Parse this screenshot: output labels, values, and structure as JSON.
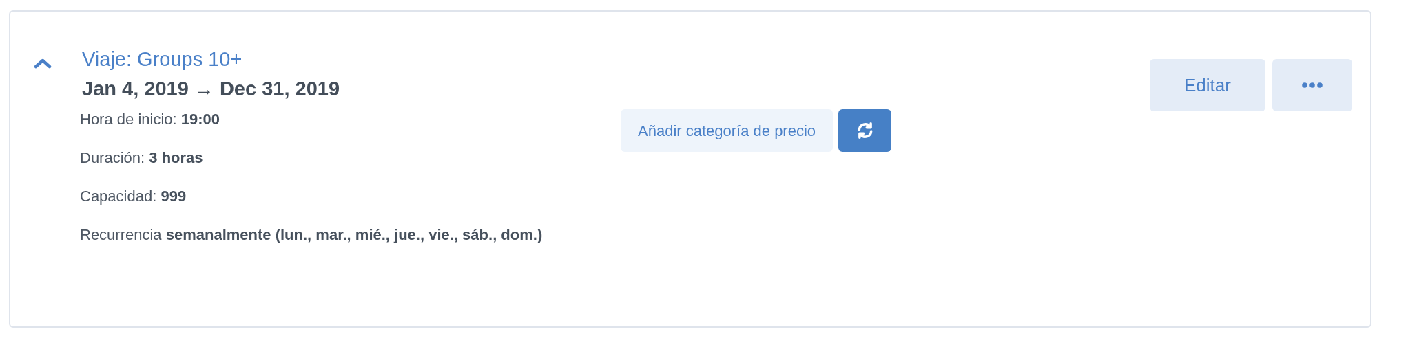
{
  "trip": {
    "expanded": true,
    "title": "Viaje: Groups 10+",
    "dates": "Jan 4, 2019 → Dec 31, 2019",
    "details": [
      "Hora de inicio: **19:00**",
      "Duración: **3 horas**",
      "Capacidad: **999**",
      "Recurrencia **semanalmente (lun., mar., mié., jue., vie., sáb., dom.)**"
    ],
    "add_price_category": "Añadir categoría de precio",
    "edit": "Editar"
  }
}
